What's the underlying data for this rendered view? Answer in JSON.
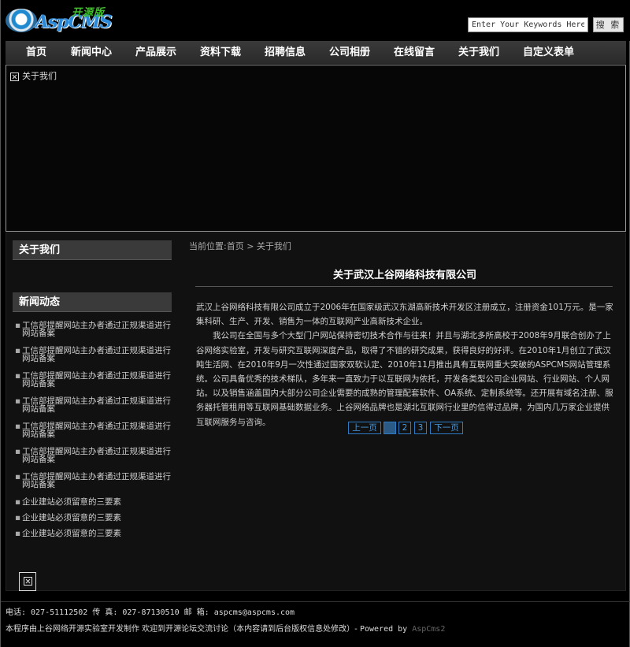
{
  "header": {
    "logo_text": "AspCMS",
    "logo_sub": "开源版",
    "search_placeholder": "Enter Your Keywords Here",
    "search_button": "搜 索"
  },
  "nav": {
    "items": [
      {
        "label": "首页"
      },
      {
        "label": "新闻中心"
      },
      {
        "label": "产品展示"
      },
      {
        "label": "资料下载"
      },
      {
        "label": "招聘信息"
      },
      {
        "label": "公司相册"
      },
      {
        "label": "在线留言"
      },
      {
        "label": "关于我们"
      },
      {
        "label": "自定义表单"
      }
    ]
  },
  "banner": {
    "alt_text": "关于我们"
  },
  "sidebar": {
    "about_title": "关于我们",
    "news_title": "新闻动态",
    "news": [
      "工信部提醒网站主办者通过正规渠道进行网站备案",
      "工信部提醒网站主办者通过正规渠道进行网站备案",
      "工信部提醒网站主办者通过正规渠道进行网站备案",
      "工信部提醒网站主办者通过正规渠道进行网站备案",
      "工信部提醒网站主办者通过正规渠道进行网站备案",
      "工信部提醒网站主办者通过正规渠道进行网站备案",
      "工信部提醒网站主办者通过正规渠道进行网站备案",
      "企业建站必须留意的三要素",
      "企业建站必须留意的三要素",
      "企业建站必须留意的三要素"
    ]
  },
  "main": {
    "breadcrumb": "当前位置:首页 > 关于我们",
    "title": "关于武汉上谷网络科技有限公司",
    "paragraph1": "武汉上谷网络科技有限公司成立于2006年在国家级武汉东湖高新技术开发区注册成立，注册资金101万元。是一家集科研、生产、开发、销售为一体的互联网产业高新技术企业。",
    "paragraph2": "我公司在全国与多个大型门户网站保持密切技术合作与往来！并且与湖北多所高校于2008年9月联合创办了上谷网络实验室，开发与研究互联网深度产品，取得了不错的研究成果，获得良好的好评。在2010年1月创立了武汉盹生活网、在2010年9月一次性通过国家双软认定、2010年11月推出具有互联网重大突破的ASPCMS网站管理系统。公司具备优秀的技术梯队，多年来一直致力于以互联网为依托，开发各类型公司企业网站、行业网站、个人网站。以及销售涵盖国内大部分公司企业需要的成熟的管理配套软件、OA系统、定制系统等。还开展有域名注册、服务器托管租用等互联网基础数据业务。上谷网络品牌也是湖北互联网行业里的信得过品牌，为国内几万家企业提供互联网服务与咨询。",
    "pager": {
      "prev": "上一页",
      "pages": [
        "1",
        "2",
        "3"
      ],
      "current": "1",
      "next": "下一页"
    }
  },
  "footer": {
    "contact": "电话: 027-51112502 传 真: 027-87130510 邮 箱: aspcms@aspcms.com",
    "copyright": "本程序由上谷网络开源实验室开发制作 欢迎到开源论坛交流讨论（本内容请到后台版权信息处修改）- ",
    "powered": "Powered by ",
    "brand": "AspCms2"
  }
}
